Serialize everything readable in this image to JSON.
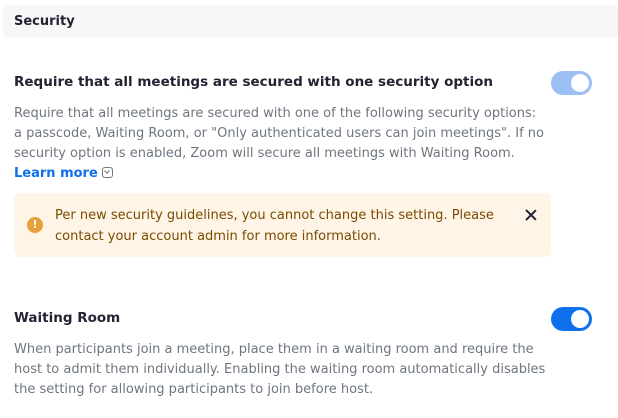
{
  "section": {
    "title": "Security"
  },
  "settings": [
    {
      "title": "Require that all meetings are secured with one security option",
      "description": "Require that all meetings are secured with one of the following security options: a passcode, Waiting Room, or \"Only authenticated users can join meetings\". If no security option is enabled, Zoom will secure all meetings with Waiting Room. ",
      "learn_more": "Learn more",
      "toggle_state": "on-disabled"
    },
    {
      "title": "Waiting Room",
      "description": "When participants join a meeting, place them in a waiting room and require the host to admit them individually. Enabling the waiting room automatically disables the setting for allowing participants to join before host.",
      "toggle_state": "on"
    }
  ],
  "notice": {
    "icon": "!",
    "text": "Per new security guidelines, you cannot change this setting. Please contact your account admin for more information."
  },
  "colors": {
    "accent": "#0e71eb",
    "accent_disabled": "#9bbff2",
    "notice_background": "#fef5e7",
    "notice_icon": "#e8a13a"
  }
}
